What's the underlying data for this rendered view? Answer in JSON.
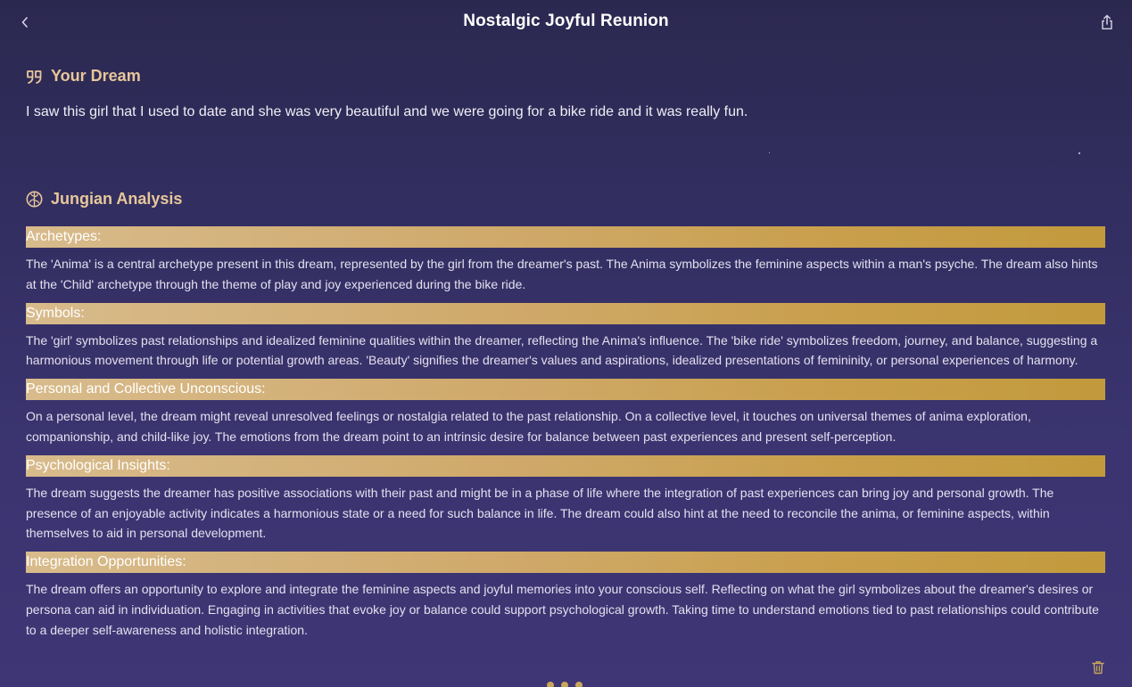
{
  "header": {
    "title": "Nostalgic Joyful Reunion",
    "back_icon": "chevron-left-icon",
    "share_icon": "share-icon"
  },
  "dream": {
    "heading": "Your Dream",
    "icon": "quote-icon",
    "text": "I saw this girl that I used to date and she was very beautiful and we were going for a bike ride and it was really fun."
  },
  "analysis": {
    "heading": "Jungian Analysis",
    "icon": "brain-icon",
    "sections": [
      {
        "title": "Archetypes:",
        "body": "The 'Anima' is a central archetype present in this dream, represented by the girl from the dreamer's past. The Anima symbolizes the feminine aspects within a man's psyche. The dream also hints at the 'Child' archetype through the theme of play and joy experienced during the bike ride."
      },
      {
        "title": "Symbols:",
        "body": "The 'girl' symbolizes past relationships and idealized feminine qualities within the dreamer, reflecting the Anima's influence. The 'bike ride' symbolizes freedom, journey, and balance, suggesting a harmonious movement through life or potential growth areas. 'Beauty' signifies the dreamer's values and aspirations, idealized presentations of femininity, or personal experiences of harmony."
      },
      {
        "title": "Personal and Collective Unconscious:",
        "body": "On a personal level, the dream might reveal unresolved feelings or nostalgia related to the past relationship. On a collective level, it touches on universal themes of anima exploration, companionship, and child-like joy. The emotions from the dream point to an intrinsic desire for balance between past experiences and present self-perception."
      },
      {
        "title": "Psychological Insights:",
        "body": "The dream suggests the dreamer has positive associations with their past and might be in a phase of life where the integration of past experiences can bring joy and personal growth. The presence of an enjoyable activity indicates a harmonious state or a need for such balance in life. The dream could also hint at the need to reconcile the anima, or feminine aspects, within themselves to aid in personal development."
      },
      {
        "title": "Integration Opportunities:",
        "body": "The dream offers an opportunity to explore and integrate the feminine aspects and joyful memories into your conscious self. Reflecting on what the girl symbolizes about the dreamer's desires or persona can aid in individuation. Engaging in activities that evoke joy or balance could support psychological growth. Taking time to understand emotions tied to past relationships could contribute to a deeper self-awareness and holistic integration."
      }
    ]
  },
  "footer": {
    "delete_icon": "trash-icon"
  },
  "colors": {
    "accent": "#e7c79a",
    "band_start": "#d8bb8c",
    "band_end": "#c29a3c",
    "background": "#322e60"
  }
}
